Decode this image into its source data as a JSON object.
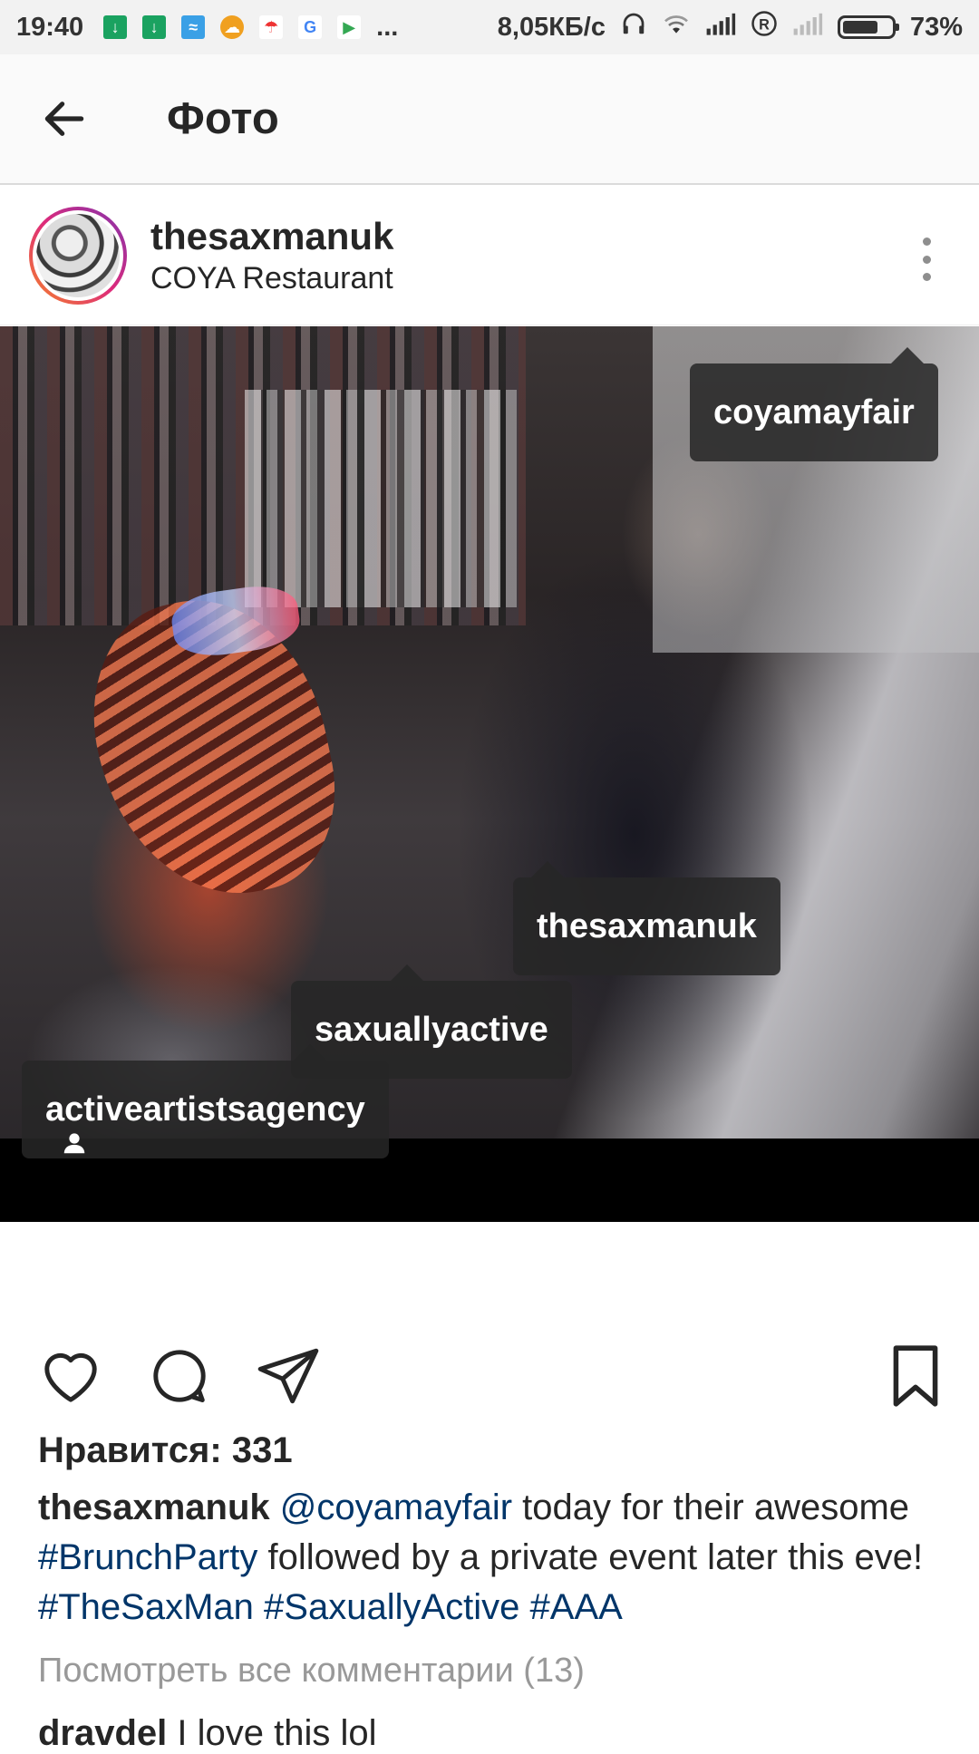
{
  "status_bar": {
    "time": "19:40",
    "network_speed": "8,05КБ/с",
    "battery": "73%",
    "more": "..."
  },
  "app_bar": {
    "title": "Фото"
  },
  "post": {
    "username": "thesaxmanuk",
    "location": "COYA Restaurant",
    "tags": [
      "coyamayfair",
      "thesaxmanuk",
      "saxuallyactive",
      "activeartistsagency"
    ],
    "likes": "Нравится: 331",
    "caption": {
      "username": "thesaxmanuk",
      "mention": "@coyamayfair",
      "text1": " today for their awesome ",
      "hashtag1": "#BrunchParty",
      "text2": " followed by a private event later this eve! ",
      "hashtag2": "#TheSaxMan",
      "hashtag3": "#SaxuallyActive",
      "hashtag4": "#AAA"
    },
    "view_comments": "Посмотреть все комментарии (13)",
    "comment": {
      "username": "dravdel",
      "text": "I love this lol"
    }
  },
  "icons": {
    "back": "arrow-left-icon",
    "more": "more-vertical-icon",
    "like": "heart-icon",
    "comment": "comment-bubble-icon",
    "share": "paper-plane-icon",
    "save": "bookmark-icon",
    "tags": "person-icon"
  }
}
